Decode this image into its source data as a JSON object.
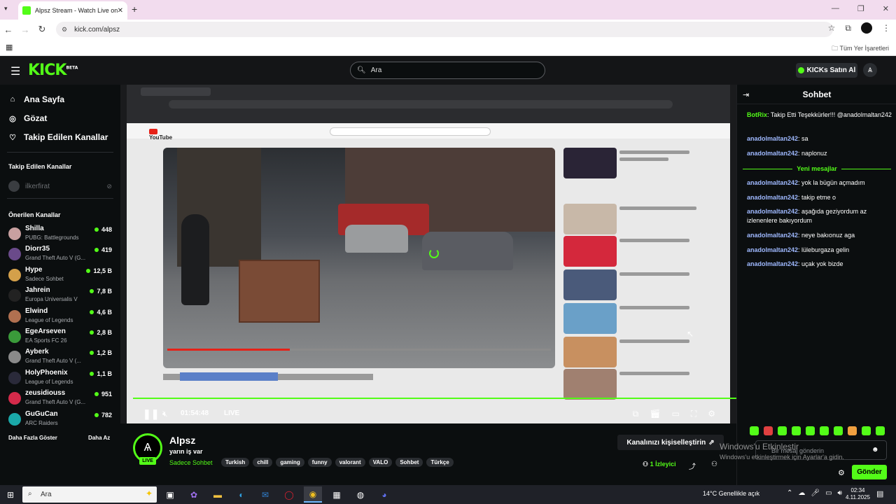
{
  "browser": {
    "tab_title": "Alpsz Stream - Watch Live on Ki",
    "url": "kick.com/alpsz",
    "bookmarks_label": "Tüm Yer İşaretleri"
  },
  "header": {
    "logo": "KICK",
    "logo_tag": "BETA",
    "search_placeholder": "Ara",
    "kicks_button": "KICKs Satın Al"
  },
  "sidebar": {
    "nav": [
      {
        "label": "Ana Sayfa",
        "icon": "home-icon"
      },
      {
        "label": "Gözat",
        "icon": "browse-icon"
      },
      {
        "label": "Takip Edilen Kanallar",
        "icon": "heart-icon"
      }
    ],
    "followed_heading": "Takip Edilen Kanallar",
    "followed_channel": "ilkerfirat",
    "recommended_heading": "Önerilen Kanallar",
    "channels": [
      {
        "name": "Shilla",
        "category": "PUBG: Battlegrounds",
        "viewers": "448",
        "color": "#c8a0a0"
      },
      {
        "name": "Diorr35",
        "category": "Grand Theft Auto V (G...",
        "viewers": "419",
        "color": "#6a4a8a"
      },
      {
        "name": "Hype",
        "category": "Sadece Sohbet",
        "viewers": "12,5 B",
        "color": "#d4a04a"
      },
      {
        "name": "Jahrein",
        "category": "Europa Universalis V",
        "viewers": "7,8 B",
        "color": "#222222"
      },
      {
        "name": "Elwind",
        "category": "League of Legends",
        "viewers": "4,6 B",
        "color": "#b07050"
      },
      {
        "name": "EgeArseven",
        "category": "EA Sports FC 26",
        "viewers": "2,8 B",
        "color": "#3a9a3a"
      },
      {
        "name": "Ayberk",
        "category": "Grand Theft Auto V (...",
        "viewers": "1,2 B",
        "color": "#8a8a8a"
      },
      {
        "name": "HolyPhoenix",
        "category": "League of Legends",
        "viewers": "1,1 B",
        "color": "#2a2a3a"
      },
      {
        "name": "zeusidiouss",
        "category": "Grand Theft Auto V (G...",
        "viewers": "951",
        "color": "#d42a4a"
      },
      {
        "name": "GuGuCan",
        "category": "ARC Raiders",
        "viewers": "782",
        "color": "#1aa8a8"
      }
    ],
    "show_more": "Daha Fazla Göster",
    "show_less": "Daha Az"
  },
  "player": {
    "time": "01:54:48",
    "live": "LIVE"
  },
  "stream": {
    "channel": "Alpsz",
    "live_badge": "LIVE",
    "title": "yarın iş var",
    "category": "Sadece Sohbet",
    "tags": [
      "Turkish",
      "chill",
      "gaming",
      "funny",
      "valorant",
      "VALO",
      "Sohbet",
      "Türkçe"
    ],
    "customize": "Kanalınızı kişiselleştirin",
    "viewers_count": "1",
    "viewers_label": "İzleyici"
  },
  "chat": {
    "title": "Sohbet",
    "messages": [
      {
        "user": "BotRix",
        "text": ": Takip Etti Teşekkürler!!! @anadolmaltan242"
      },
      {
        "user": "anadolmaltan242",
        "text": ": sa"
      },
      {
        "user": "anadolmaltan242",
        "text": ": naplonuz"
      },
      {
        "user": "anadolmaltan242",
        "text": ": yok la bügün açmadım"
      },
      {
        "user": "anadolmaltan242",
        "text": ": takip etme o"
      },
      {
        "user": "anadolmaltan242",
        "text": ": aşağıda geziyordum az izlenenlere bakıyordum"
      },
      {
        "user": "anadolmaltan242",
        "text": ": neye bakıonuz aga"
      },
      {
        "user": "anadolmaltan242",
        "text": ": lüleburgaza gelin"
      },
      {
        "user": "anadolmaltan242",
        "text": ": uçak yok bizde"
      }
    ],
    "new_messages": "Yeni mesajlar",
    "input_placeholder": "Bir mesaj gönderin",
    "send": "Gönder",
    "windows_activate": "Windows'u Etkinleştir",
    "windows_activate_sub": "Windows'u etkinleştirmek için Ayarlar'a gidin."
  },
  "taskbar": {
    "search": "Ara",
    "weather": "14°C  Genellikle açık",
    "time": "02:34",
    "date": "4.11.2025"
  }
}
